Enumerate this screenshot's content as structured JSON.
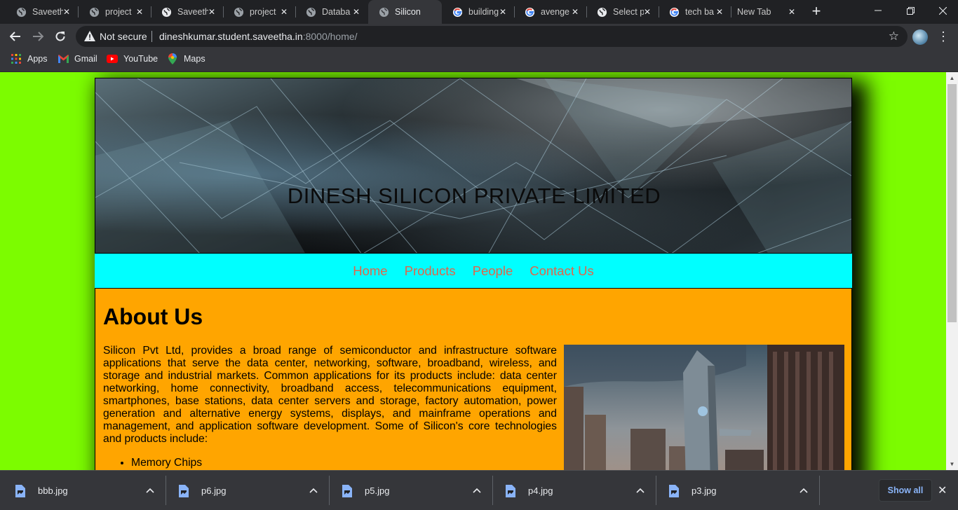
{
  "browser": {
    "tabs": [
      {
        "title": "Saveeth",
        "icon": "globe-icon",
        "active": false
      },
      {
        "title": "project",
        "icon": "globe-icon",
        "active": false
      },
      {
        "title": "Saveeth",
        "icon": "globe-icon",
        "active": false
      },
      {
        "title": "project",
        "icon": "globe-icon",
        "active": false
      },
      {
        "title": "Databa",
        "icon": "globe-icon",
        "active": false
      },
      {
        "title": "Silicon",
        "icon": "globe-icon",
        "active": true
      },
      {
        "title": "building",
        "icon": "google-icon",
        "active": false
      },
      {
        "title": "avenge",
        "icon": "google-icon",
        "active": false
      },
      {
        "title": "Select p",
        "icon": "globe-icon",
        "active": false
      },
      {
        "title": "tech ba",
        "icon": "google-icon",
        "active": false
      },
      {
        "title": "New Tab",
        "icon": "none",
        "active": false
      }
    ],
    "address": {
      "security_label": "Not secure",
      "url_host": "dineshkumar.student.saveetha.in",
      "url_rest": ":8000/home/"
    },
    "bookmarks": [
      {
        "label": "Apps",
        "icon": "apps-grid-icon"
      },
      {
        "label": "Gmail",
        "icon": "gmail-icon"
      },
      {
        "label": "YouTube",
        "icon": "youtube-icon"
      },
      {
        "label": "Maps",
        "icon": "maps-pin-icon"
      }
    ]
  },
  "page": {
    "banner_title": "DINESH SILICON PRIVATE LIMITED",
    "nav": [
      "Home",
      "Products",
      "People",
      "Contact Us"
    ],
    "about_heading": "About Us",
    "about_paragraph": "Silicon Pvt Ltd, provides a broad range of semiconductor and infrastructure software applications that serve the data center, networking, software, broadband, wireless, and storage and industrial markets. Common applications for its products include: data center networking, home connectivity, broadband access, telecommunications equipment, smartphones, base stations, data center servers and storage, factory automation, power generation and alternative energy systems, displays, and mainframe operations and management, and application software development. Some of Silicon's core technologies and products include:",
    "about_list": [
      "Memory Chips"
    ],
    "colors": {
      "page_bg": "#7cfc00",
      "nav_bg": "#00ffff",
      "nav_link": "#e0664a",
      "content_bg": "#ffa500"
    }
  },
  "downloads": {
    "files": [
      "bbb.jpg",
      "p6.jpg",
      "p5.jpg",
      "p4.jpg",
      "p3.jpg"
    ],
    "show_all_label": "Show all"
  }
}
